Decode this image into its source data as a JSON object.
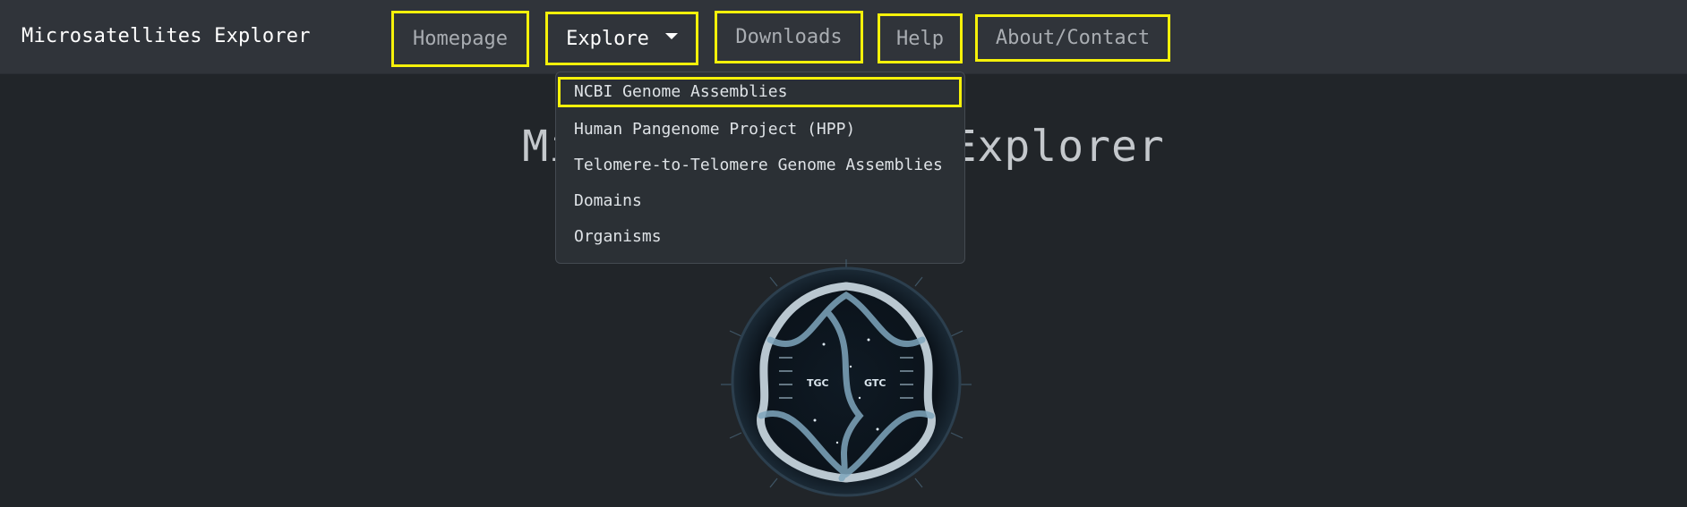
{
  "navbar": {
    "brand": "Microsatellites Explorer",
    "items": [
      {
        "label": "Homepage"
      },
      {
        "label": "Explore"
      },
      {
        "label": "Downloads"
      },
      {
        "label": "Help"
      },
      {
        "label": "About/Contact"
      }
    ]
  },
  "hero": {
    "title": "Microsatellites Explorer"
  },
  "explore_menu": {
    "items": [
      {
        "label": "NCBI Genome Assemblies"
      },
      {
        "label": "Human Pangenome Project (HPP)"
      },
      {
        "label": "Telomere-to-Telomere Genome Assemblies"
      },
      {
        "label": "Domains"
      },
      {
        "label": "Organisms"
      }
    ]
  },
  "logo": {
    "icon": "dna-double-helix-logo",
    "text_left": "TGC",
    "text_right": "GTC"
  },
  "colors": {
    "background": "#212529",
    "navbar": "#30343a",
    "highlight": "#f5f10a",
    "dropdown": "#2b3035"
  }
}
